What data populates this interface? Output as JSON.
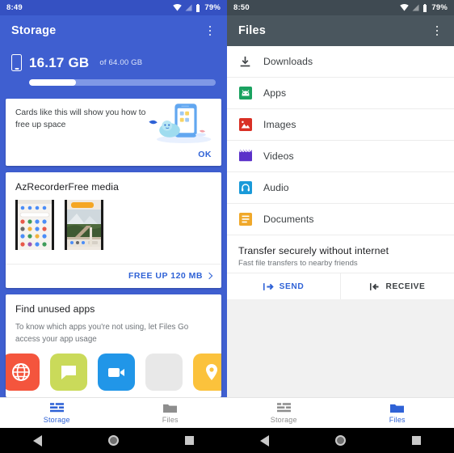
{
  "left": {
    "statusbar": {
      "time": "8:49",
      "battery": "79%",
      "wifi_icon": "wifi-icon",
      "signal_icon": "signal-icon",
      "battery_icon": "battery-icon"
    },
    "appbar": {
      "title": "Storage",
      "overflow_icon": "more-vert-icon"
    },
    "storage": {
      "used": "16.17 GB",
      "of_total": "of 64.00 GB",
      "percent_used": 25,
      "device_icon": "phone-icon"
    },
    "cards": {
      "promo": {
        "text": "Cards like this will show you how to free up space",
        "ok_label": "OK",
        "art_icon": "phone-illustration"
      },
      "media": {
        "title": "AzRecorderFree media",
        "free_up_label": "FREE UP 120 MB",
        "chevron_icon": "chevron-right-icon"
      },
      "unused": {
        "title": "Find unused apps",
        "description": "To know which apps you're not using, let Files Go access your app usage",
        "app_icons": [
          "globe-app-icon",
          "message-app-icon",
          "video-camera-app-icon",
          "blank-app-icon",
          "location-app-icon"
        ],
        "app_colors": [
          "#f4553d",
          "#cada5a",
          "#2196e8",
          "#e8e8e8",
          "#fbc23c"
        ]
      }
    },
    "nav": [
      {
        "label": "Storage",
        "icon": "storage-list-icon",
        "active": true
      },
      {
        "label": "Files",
        "icon": "folder-icon",
        "active": false
      }
    ]
  },
  "right": {
    "statusbar": {
      "time": "8:50",
      "battery": "79%",
      "wifi_icon": "wifi-icon",
      "signal_icon": "signal-icon",
      "battery_icon": "battery-icon"
    },
    "appbar": {
      "title": "Files",
      "overflow_icon": "more-vert-icon"
    },
    "files": [
      {
        "label": "Downloads",
        "icon": "download-icon",
        "color": "#3c4043"
      },
      {
        "label": "Apps",
        "icon": "apps-android-icon",
        "color": "#1aa260"
      },
      {
        "label": "Images",
        "icon": "image-icon",
        "color": "#d93025"
      },
      {
        "label": "Videos",
        "icon": "video-icon",
        "color": "#5b31c9"
      },
      {
        "label": "Audio",
        "icon": "audio-headphone-icon",
        "color": "#1a9ad9"
      },
      {
        "label": "Documents",
        "icon": "document-icon",
        "color": "#f0a82a"
      }
    ],
    "transfer": {
      "title": "Transfer securely without internet",
      "subtitle": "Fast file transfers to nearby friends",
      "send_label": "SEND",
      "receive_label": "RECEIVE",
      "send_icon": "send-arrow-icon",
      "receive_icon": "receive-arrow-icon"
    },
    "nav": [
      {
        "label": "Storage",
        "icon": "storage-list-icon",
        "active": false
      },
      {
        "label": "Files",
        "icon": "folder-icon",
        "active": true
      }
    ]
  },
  "system": {
    "back_icon": "back-triangle-icon",
    "home_icon": "home-circle-icon",
    "recents_icon": "recents-square-icon"
  },
  "colors": {
    "blue": "#3f5fd0",
    "blue_dark": "#3551c2",
    "slate": "#4a565e",
    "slate_dark": "#3f4a52",
    "accent": "#2f62d6"
  }
}
